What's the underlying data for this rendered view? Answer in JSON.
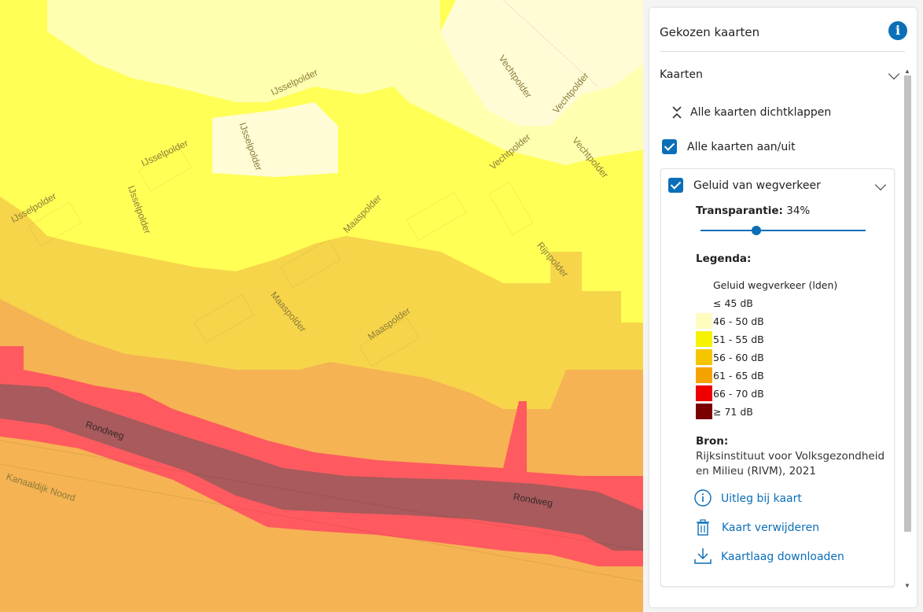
{
  "map": {
    "street_labels": [
      {
        "id": "ijsselpolder-1",
        "text": "IJsselpolder"
      },
      {
        "id": "ijsselpolder-2",
        "text": "IJsselpolder"
      },
      {
        "id": "ijsselpolder-3",
        "text": "IJsselpolder"
      },
      {
        "id": "ijsselpolder-4",
        "text": "IJsselpolder"
      },
      {
        "id": "ijsselpolder-5",
        "text": "IJsselpolder"
      },
      {
        "id": "vechtpolder-1",
        "text": "Vechtpolder"
      },
      {
        "id": "vechtpolder-2",
        "text": "Vechtpolder"
      },
      {
        "id": "vechtpolder-3",
        "text": "Vechtpolder"
      },
      {
        "id": "vechtpolder-4",
        "text": "Vechtpolder"
      },
      {
        "id": "maaspolder-1",
        "text": "Maaspolder"
      },
      {
        "id": "maaspolder-2",
        "text": "Maaspolder"
      },
      {
        "id": "maaspolder-3",
        "text": "Maaspolder"
      },
      {
        "id": "rijnpolder",
        "text": "Rijnpolder"
      },
      {
        "id": "rondweg-1",
        "text": "Rondweg"
      },
      {
        "id": "rondweg-2",
        "text": "Rondweg"
      },
      {
        "id": "kanaaldijk",
        "text": "Kanaaldijk Noord"
      }
    ],
    "colors": {
      "le45": "#fffcd6",
      "c46_50": "#ffffb0",
      "c51_55": "#ffff55",
      "c56_60": "#f7d54a",
      "c61_65": "#f5b353",
      "c66_70": "#ff5a5f",
      "c71": "#a85a5c"
    }
  },
  "panel": {
    "title": "Gekozen kaarten",
    "info_icon": "info-icon",
    "section_title": "Kaarten",
    "collapse_all": "Alle kaarten dichtklappen",
    "toggle_all": "Alle kaarten aan/uit",
    "layer": {
      "name": "Geluid van wegverkeer",
      "transparency_label": "Transparantie:",
      "transparency_value": "34%",
      "transparency_fraction": 0.34,
      "legend_title": "Legenda:",
      "legend_heading": "Geluid wegverkeer (lden)",
      "legend": [
        {
          "label": "≤ 45 dB",
          "color": "#ffffff"
        },
        {
          "label": "46 - 50 dB",
          "color": "#fffcc0"
        },
        {
          "label": "51 - 55 dB",
          "color": "#f6f200"
        },
        {
          "label": "56 - 60 dB",
          "color": "#f7c400"
        },
        {
          "label": "61 - 65 dB",
          "color": "#f5a300"
        },
        {
          "label": "66 - 70 dB",
          "color": "#ee0000"
        },
        {
          "label": "≥ 71 dB",
          "color": "#7a0000"
        }
      ],
      "source_label": "Bron:",
      "source_line1": "Rijksinstituut voor Volksgezondheid",
      "source_line2": "en Milieu (RIVM), 2021",
      "links": {
        "explain": "Uitleg bij kaart",
        "remove": "Kaart verwijderen",
        "download": "Kaartlaag downloaden"
      }
    }
  }
}
